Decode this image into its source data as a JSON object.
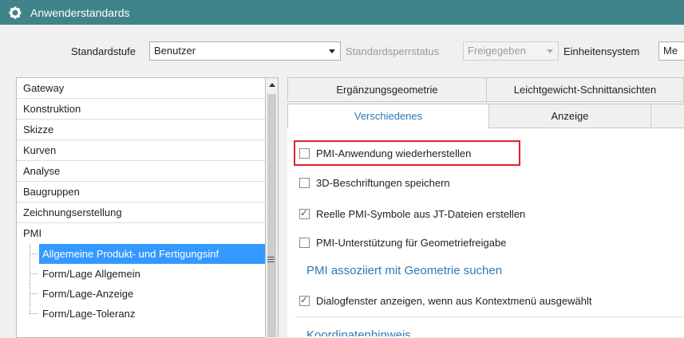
{
  "window": {
    "title": "Anwenderstandards",
    "icon": "gear-icon"
  },
  "toolbar": {
    "standardstufe_label": "Standardstufe",
    "standardstufe_value": "Benutzer",
    "sperrstatus_label": "Standardsperrstatus",
    "sperrstatus_value": "Freigegeben",
    "einheiten_label": "Einheitensystem",
    "einheiten_value": "Me"
  },
  "tree": {
    "items": [
      "Gateway",
      "Konstruktion",
      "Skizze",
      "Kurven",
      "Analyse",
      "Baugruppen",
      "Zeichnungserstellung",
      "PMI"
    ],
    "children": [
      "Allgemeine Produkt- und Fertigungsinf",
      "Form/Lage Allgemein",
      "Form/Lage-Anzeige",
      "Form/Lage-Toleranz"
    ],
    "selected_child": 0
  },
  "tabs": {
    "row1": [
      "Ergänzungsgeometrie",
      "Leichtgewicht-Schnittansichten"
    ],
    "row2": [
      "Verschiedenes",
      "Anzeige"
    ],
    "active": "Verschiedenes"
  },
  "options": [
    {
      "label": "PMI-Anwendung wiederherstellen",
      "checked": false
    },
    {
      "label": "3D-Beschriftungen speichern",
      "checked": false
    },
    {
      "label": "Reelle PMI-Symbole aus JT-Dateien erstellen",
      "checked": true
    },
    {
      "label": "PMI-Unterstützung für Geometriefreigabe",
      "checked": false
    }
  ],
  "section": {
    "title": "PMI assoziiert mit Geometrie suchen",
    "option": {
      "label": "Dialogfenster anzeigen, wenn aus Kontextmenü ausgewählt",
      "checked": true
    }
  },
  "next_section_title": "Koordinatenhinweis",
  "colors": {
    "titlebar": "#3f8489",
    "selection": "#3399ff",
    "accent": "#2f79b5",
    "highlight": "#e0242f"
  }
}
